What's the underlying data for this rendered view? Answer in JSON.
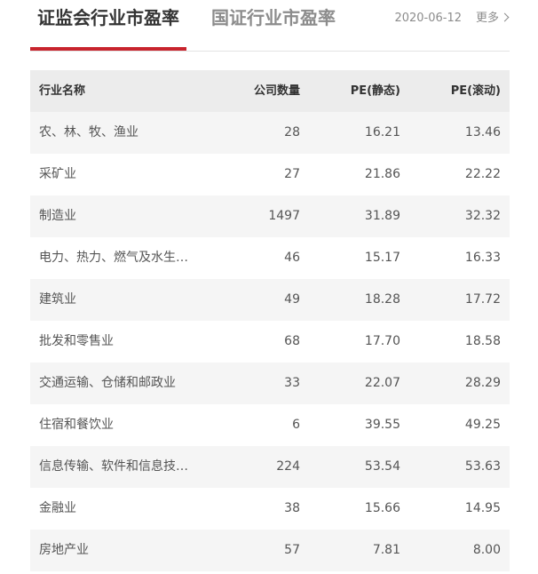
{
  "header": {
    "tabs": [
      {
        "label": "证监会行业市盈率",
        "active": true
      },
      {
        "label": "国证行业市盈率",
        "active": false
      }
    ],
    "date": "2020-06-12",
    "more_label": "更多"
  },
  "colors": {
    "accent": "#c8242d",
    "header_bg": "#ececec",
    "stripe_bg": "#f5f5f5"
  },
  "table": {
    "columns": [
      "行业名称",
      "公司数量",
      "PE(静态)",
      "PE(滚动)"
    ],
    "rows": [
      {
        "name": "农、林、牧、渔业",
        "count": "28",
        "pe_static": "16.21",
        "pe_ttm": "13.46"
      },
      {
        "name": "采矿业",
        "count": "27",
        "pe_static": "21.86",
        "pe_ttm": "22.22"
      },
      {
        "name": "制造业",
        "count": "1497",
        "pe_static": "31.89",
        "pe_ttm": "32.32"
      },
      {
        "name": "电力、热力、燃气及水生…",
        "count": "46",
        "pe_static": "15.17",
        "pe_ttm": "16.33"
      },
      {
        "name": "建筑业",
        "count": "49",
        "pe_static": "18.28",
        "pe_ttm": "17.72"
      },
      {
        "name": "批发和零售业",
        "count": "68",
        "pe_static": "17.70",
        "pe_ttm": "18.58"
      },
      {
        "name": "交通运输、仓储和邮政业",
        "count": "33",
        "pe_static": "22.07",
        "pe_ttm": "28.29"
      },
      {
        "name": "住宿和餐饮业",
        "count": "6",
        "pe_static": "39.55",
        "pe_ttm": "49.25"
      },
      {
        "name": "信息传输、软件和信息技…",
        "count": "224",
        "pe_static": "53.54",
        "pe_ttm": "53.63"
      },
      {
        "name": "金融业",
        "count": "38",
        "pe_static": "15.66",
        "pe_ttm": "14.95"
      },
      {
        "name": "房地产业",
        "count": "57",
        "pe_static": "7.81",
        "pe_ttm": "8.00"
      }
    ]
  }
}
